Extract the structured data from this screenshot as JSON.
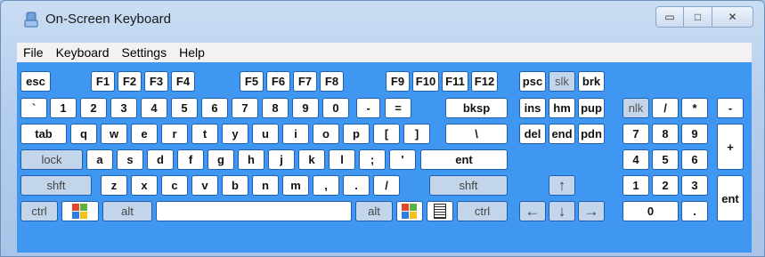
{
  "title": "On-Screen Keyboard",
  "menu": [
    "File",
    "Keyboard",
    "Settings",
    "Help"
  ],
  "keys": {
    "esc": "esc",
    "f1": "F1",
    "f2": "F2",
    "f3": "F3",
    "f4": "F4",
    "f5": "F5",
    "f6": "F6",
    "f7": "F7",
    "f8": "F8",
    "f9": "F9",
    "f10": "F10",
    "f11": "F11",
    "f12": "F12",
    "psc": "psc",
    "slk": "slk",
    "brk": "brk",
    "backtick": "`",
    "d1": "1",
    "d2": "2",
    "d3": "3",
    "d4": "4",
    "d5": "5",
    "d6": "6",
    "d7": "7",
    "d8": "8",
    "d9": "9",
    "d0": "0",
    "minus": "-",
    "equals": "=",
    "bksp": "bksp",
    "ins": "ins",
    "hm": "hm",
    "pup": "pup",
    "nlk": "nlk",
    "np_slash": "/",
    "np_star": "*",
    "np_minus": "-",
    "tab": "tab",
    "q": "q",
    "w": "w",
    "e": "e",
    "r": "r",
    "t": "t",
    "y": "y",
    "u": "u",
    "i": "i",
    "o": "o",
    "p": "p",
    "lbracket": "[",
    "rbracket": "]",
    "backslash": "\\",
    "del": "del",
    "end": "end",
    "pdn": "pdn",
    "np7": "7",
    "np8": "8",
    "np9": "9",
    "np_plus": "+",
    "lock": "lock",
    "a": "a",
    "s": "s",
    "d": "d",
    "f": "f",
    "g": "g",
    "h": "h",
    "j": "j",
    "k": "k",
    "l": "l",
    "semicolon": ";",
    "quote": "'",
    "ent": "ent",
    "np4": "4",
    "np5": "5",
    "np6": "6",
    "shft": "shft",
    "z": "z",
    "x": "x",
    "c": "c",
    "v": "v",
    "b": "b",
    "n": "n",
    "m": "m",
    "comma": ",",
    "period": ".",
    "slash": "/",
    "shft_r": "shft",
    "np1": "1",
    "np2": "2",
    "np3": "3",
    "np_ent": "ent",
    "ctrl": "ctrl",
    "alt": "alt",
    "alt_r": "alt",
    "ctrl_r": "ctrl",
    "np0": "0",
    "np_dot": ".",
    "up": "↑",
    "left": "←",
    "down": "↓",
    "right": "→"
  },
  "colors": {
    "keyboard_bg": "#3f97f2",
    "key_bg": "#ffffff",
    "key_toggle_bg": "#c3d5ea"
  }
}
